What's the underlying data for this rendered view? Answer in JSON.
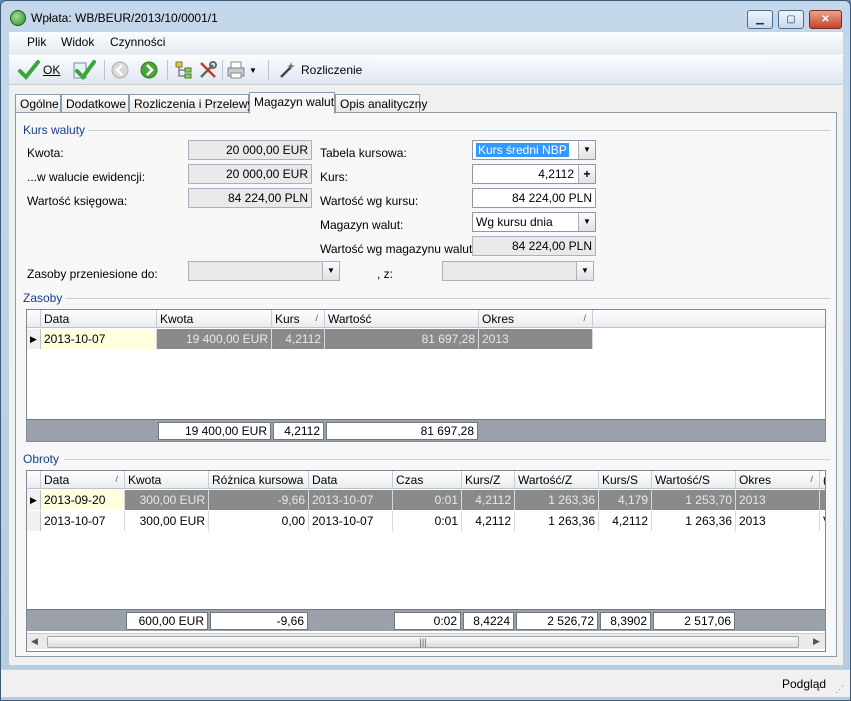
{
  "window": {
    "title": "Wpłata: WB/BEUR/2013/10/0001/1",
    "minimize": "▁",
    "maximize": "▢",
    "close": "✕"
  },
  "menu": {
    "plik": "Plik",
    "widok": "Widok",
    "czynnosci": "Czynności"
  },
  "toolbar": {
    "ok_label": "OK",
    "rozliczenie_label": "Rozliczenie"
  },
  "tabs": [
    "Ogólne",
    "Dodatkowe",
    "Rozliczenia i Przelewy",
    "Magazyn walut",
    "Opis analityczny"
  ],
  "kurs_waluty": {
    "group_title": "Kurs waluty",
    "kwota_label": "Kwota:",
    "kwota_value": "20 000,00 EUR",
    "waluta_ewidencji_label": "...w walucie ewidencji:",
    "waluta_ewidencji_value": "20 000,00 EUR",
    "wartosc_ksiegowa_label": "Wartość księgowa:",
    "wartosc_ksiegowa_value": "84 224,00 PLN",
    "tabela_kursowa_label": "Tabela kursowa:",
    "tabela_kursowa_value": "Kurs średni NBP",
    "kurs_label": "Kurs:",
    "kurs_value": "4,2112",
    "wartosc_wg_kursu_label": "Wartość wg kursu:",
    "wartosc_wg_kursu_value": "84 224,00 PLN",
    "magazyn_walut_label": "Magazyn walut:",
    "magazyn_walut_value": "Wg kursu dnia",
    "wartosc_wg_magazynu_label": "Wartość wg magazynu walut:",
    "wartosc_wg_magazynu_value": "84 224,00 PLN",
    "zasoby_przeniesione_label": "Zasoby przeniesione do:",
    "z_label": ", z:"
  },
  "zasoby": {
    "group_title": "Zasoby",
    "headers": [
      "Data",
      "Kwota",
      "Kurs",
      "Wartość",
      "Okres"
    ],
    "rows": [
      [
        "2013-10-07",
        "19 400,00 EUR",
        "4,2112",
        "81 697,28",
        "2013"
      ]
    ],
    "footer": [
      "19 400,00 EUR",
      "4,2112",
      "81 697,28"
    ]
  },
  "obroty": {
    "group_title": "Obroty",
    "headers": [
      "Data",
      "Kwota",
      "Różnica kursowa",
      "Data",
      "Czas",
      "Kurs/Z",
      "Wartość/Z",
      "Kurs/S",
      "Wartość/S",
      "Okres",
      "("
    ],
    "rows": [
      [
        "2013-09-20",
        "300,00 EUR",
        "-9,66",
        "2013-10-07",
        "0:01",
        "4,2112",
        "1 263,36",
        "4,179",
        "1 253,70",
        "2013",
        ""
      ],
      [
        "2013-10-07",
        "300,00 EUR",
        "0,00",
        "2013-10-07",
        "0:01",
        "4,2112",
        "1 263,36",
        "4,2112",
        "1 263,36",
        "2013",
        "V"
      ]
    ],
    "footer": [
      "600,00 EUR",
      "-9,66",
      "0:02",
      "8,4224",
      "2 526,72",
      "8,3902",
      "2 517,06"
    ]
  },
  "status": {
    "podglad": "Podgląd"
  },
  "colors": {
    "accent": "#1a3f86",
    "selection": "#3399ff",
    "highlight_row": "#8a8a8a"
  }
}
